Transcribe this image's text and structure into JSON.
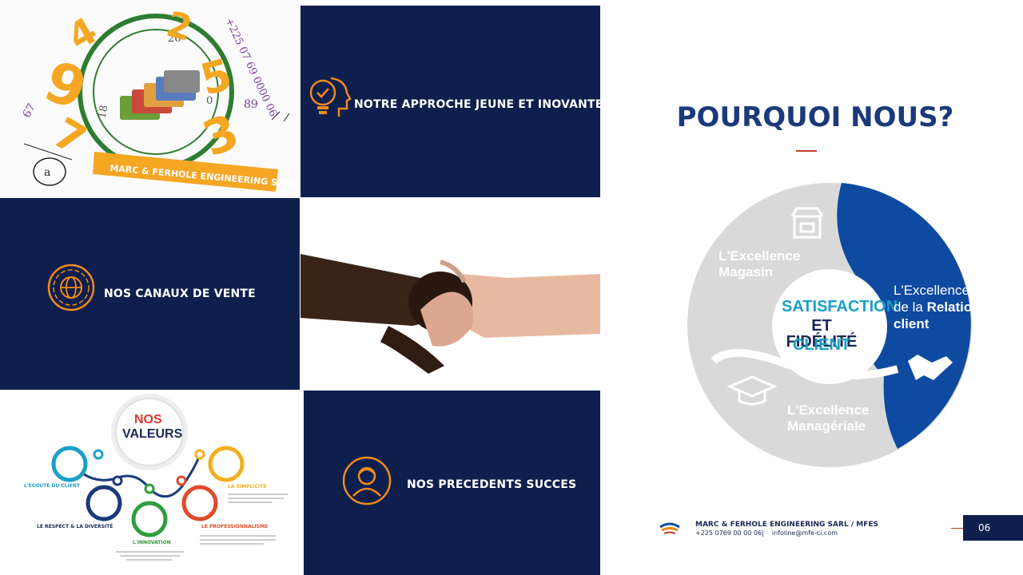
{
  "tile1": {
    "numbers": [
      "4",
      "2",
      "9",
      "5",
      "3",
      "7"
    ],
    "phone_text": "+225 07 69 0000 06",
    "small_nums": [
      "26",
      "18",
      "89",
      "0",
      "2",
      "67"
    ],
    "banner": "MARC & FERHOLE ENGINEERING SARL"
  },
  "tile2": {
    "label": "NOTRE APPROCHE JEUNE ET INOVANTE",
    "icon": "idea-head-icon"
  },
  "tile3": {
    "label": "NOS CANAUX DE VENTE",
    "icon": "globe-icon"
  },
  "tile4": {
    "icon": "handshake-photo"
  },
  "tile5": {
    "title_line1": "NOS",
    "title_line2": "VALEURS",
    "values": [
      {
        "label": "L'ÉCOUTE DU CLIENT"
      },
      {
        "label": "LE RESPECT & LA DIVERSITÉ"
      },
      {
        "label": "L'INNOVATION"
      },
      {
        "label": "LE PROFESSIONNALISME"
      },
      {
        "label": "LA SIMPLICITÉ"
      }
    ]
  },
  "tile6": {
    "label": "NOS PRECEDENTS SUCCES",
    "icon": "person-icon"
  },
  "right": {
    "title": "POURQUOI NOUS?",
    "accent": "#c0392b",
    "center_line1": "SATISFACTION",
    "center_line2": "ET FIDÉLITÉ",
    "center_line3": "CLIENT",
    "seg_magasin_1": "L'Excellence",
    "seg_magasin_2": "Magasin",
    "seg_relation_1": "L'Excellence",
    "seg_relation_2a": "de la ",
    "seg_relation_2b": "Relation",
    "seg_relation_3": "client",
    "seg_manag_1": "L'Excellence",
    "seg_manag_2": "Managériale"
  },
  "footer": {
    "company": "MARC & FERHOLE ENGINEERING SARL / MFES",
    "contact": "+225 0769 00 00 06|    infoline@mfe-ci.com",
    "page_number": "06"
  },
  "colors": {
    "navy": "#0f1f4d",
    "orange": "#f08a1c",
    "blue": "#0d4aa0",
    "gray": "#d9d9d9",
    "teal": "#1a9fc9"
  }
}
